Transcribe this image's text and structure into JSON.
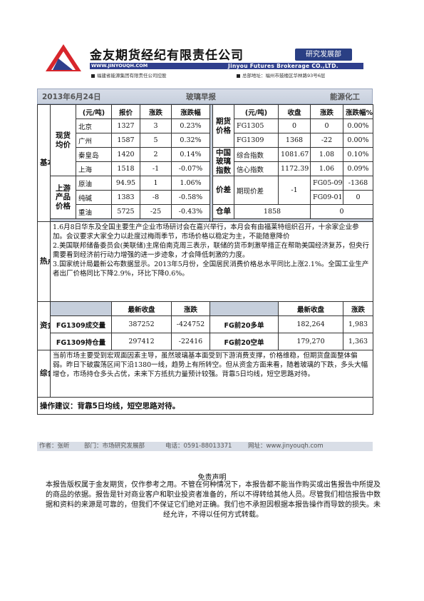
{
  "header": {
    "company_cn": "金友期货经纪有限责任公司",
    "dept": "研究发展部",
    "site": "WWW.JINYOUQH.COM",
    "company_en": "Jinyou Futures Brokerage CO.,LTD.",
    "parent": "福建省能源集团有限责任公司控股",
    "address": "总部地址：福州市鼓楼区华林路93号6层"
  },
  "titlebar": {
    "date": "2013年6月24日",
    "report": "玻璃早报",
    "sector": "能源化工"
  },
  "basics": {
    "section_label": "基本面",
    "spot_label": "现货均价",
    "upstream_label": "上游产品价格",
    "left_headers": [
      "(元/吨)",
      "报价",
      "涨跌",
      "涨跌幅"
    ],
    "spot_rows": [
      {
        "name": "北京",
        "price": "1327",
        "chg": "3",
        "pct": "0.23%"
      },
      {
        "name": "广州",
        "price": "1587",
        "chg": "5",
        "pct": "0.32%"
      },
      {
        "name": "秦皇岛",
        "price": "1420",
        "chg": "2",
        "pct": "0.14%"
      },
      {
        "name": "上海",
        "price": "1518",
        "chg": "-1",
        "pct": "-0.07%"
      }
    ],
    "upstream_rows": [
      {
        "name": "原油",
        "price": "94.95",
        "chg": "1",
        "pct": "1.06%"
      },
      {
        "name": "纯碱",
        "price": "1383",
        "chg": "-8",
        "pct": "-0.58%"
      },
      {
        "name": "重油",
        "price": "5725",
        "chg": "-25",
        "pct": "-0.43%"
      }
    ],
    "right_headers": [
      "(元/吨)",
      "收盘",
      "涨跌",
      "涨跌幅%"
    ],
    "futures_label": "期货价格",
    "futures_rows": [
      {
        "name": "FG1305",
        "close": "0",
        "chg": "0",
        "pct": "0.00%"
      },
      {
        "name": "FG1309",
        "close": "1368",
        "chg": "-22",
        "pct": "0.00%"
      }
    ],
    "index_label": "中国玻璃指数",
    "index_rows": [
      {
        "name": "综合指数",
        "close": "1081.67",
        "chg": "1.08",
        "pct": "0.10%"
      },
      {
        "name": "信心指数",
        "close": "1172.39",
        "chg": "1.06",
        "pct": "0.09%"
      }
    ],
    "spread_label": "价差",
    "spread_name": "期现价差",
    "spread_value": "-1",
    "spread_rows": [
      {
        "name": "FG05-09",
        "value": "-1368"
      },
      {
        "name": "FG09-01",
        "value": "0"
      }
    ],
    "warehouse_label": "仓单",
    "warehouse_value": "1858",
    "warehouse_chg": "0"
  },
  "news": {
    "label": "热点新闻",
    "items": [
      "1.6月8日华东及全国主要生产企业市场研讨会在嘉兴举行，本月会有由福莱特组织召开，十余家企业参加。会议要求大家全力以赴度过梅雨季节，市场价格以稳定为主，不能随意降价",
      "2.美国联邦储备委员会(美联储)主席伯南克周三表示，联储的货币刺激举措正在帮助美国经济复苏，但央行需要看到经济前行动力增强的进一步迹象，才会降低刺激的力度。",
      "3.国家统计局最新公布数据显示。2013年5月份，全国居民消费价格总水平同比上涨2.1%。全国工业生产者出厂价格同比下降2.9%，环比下降0.6%。"
    ]
  },
  "funds": {
    "label": "资金面",
    "headers_left": [
      "最新收盘",
      "涨跌"
    ],
    "headers_right": [
      "最新收盘",
      "涨跌"
    ],
    "rows": [
      {
        "left_name": "FG1309成交量",
        "left_close": "387252",
        "left_chg": "-424752",
        "right_name": "FG前20多单",
        "right_close": "182,264",
        "right_chg": "1,983"
      },
      {
        "left_name": "FG1309持仓量",
        "left_close": "297412",
        "left_chg": "-22416",
        "right_name": "FG前20空单",
        "right_close": "179,270",
        "right_chg": "1,363"
      }
    ]
  },
  "analysis": {
    "label": "综合分析",
    "text": "当前市场主要受到宏观面因素主导，虽然玻璃基本面受到下游消费支撑，价格维稳，但期货盘面整体偏弱。昨日下破震荡区间下沿1380一线，趋势上有所转空。但从资金方面来看，随着玻璃的下跌，多头大幅增仓，市场持仓多头占优，未来下方抵抗力量预计较强。背靠5日均线，短空思路对待。"
  },
  "advice": {
    "text": "操作建议：背靠5日均线，短空思路对待。"
  },
  "footer": {
    "author": "作者：张昕",
    "dept": "部门：市场研究发展部",
    "phone": "电话：0591-88013371",
    "web": "网址：www.jinyouqh.com"
  },
  "disclaimer": {
    "title": "免责声明",
    "body": "本报告版权属于金友期货，仅作参考之用。不管在何种情况下，本报告都不能当作购买或出售报告中所提及的商品的依据。报告是针对商业客户和职业投资者准备的，所以不得转给其他人员。尽管我们相信报告中数据和资料的来源是可靠的，但我们不保证它们绝对正确。我们也不承担因根据本报告操作而导致的损失。未经允许，不得以任何方式转载。"
  },
  "colors": {
    "brand_blue": "#2f3f8d",
    "logo_red": "#d8262c",
    "title_bar": "#c7cfdd"
  }
}
